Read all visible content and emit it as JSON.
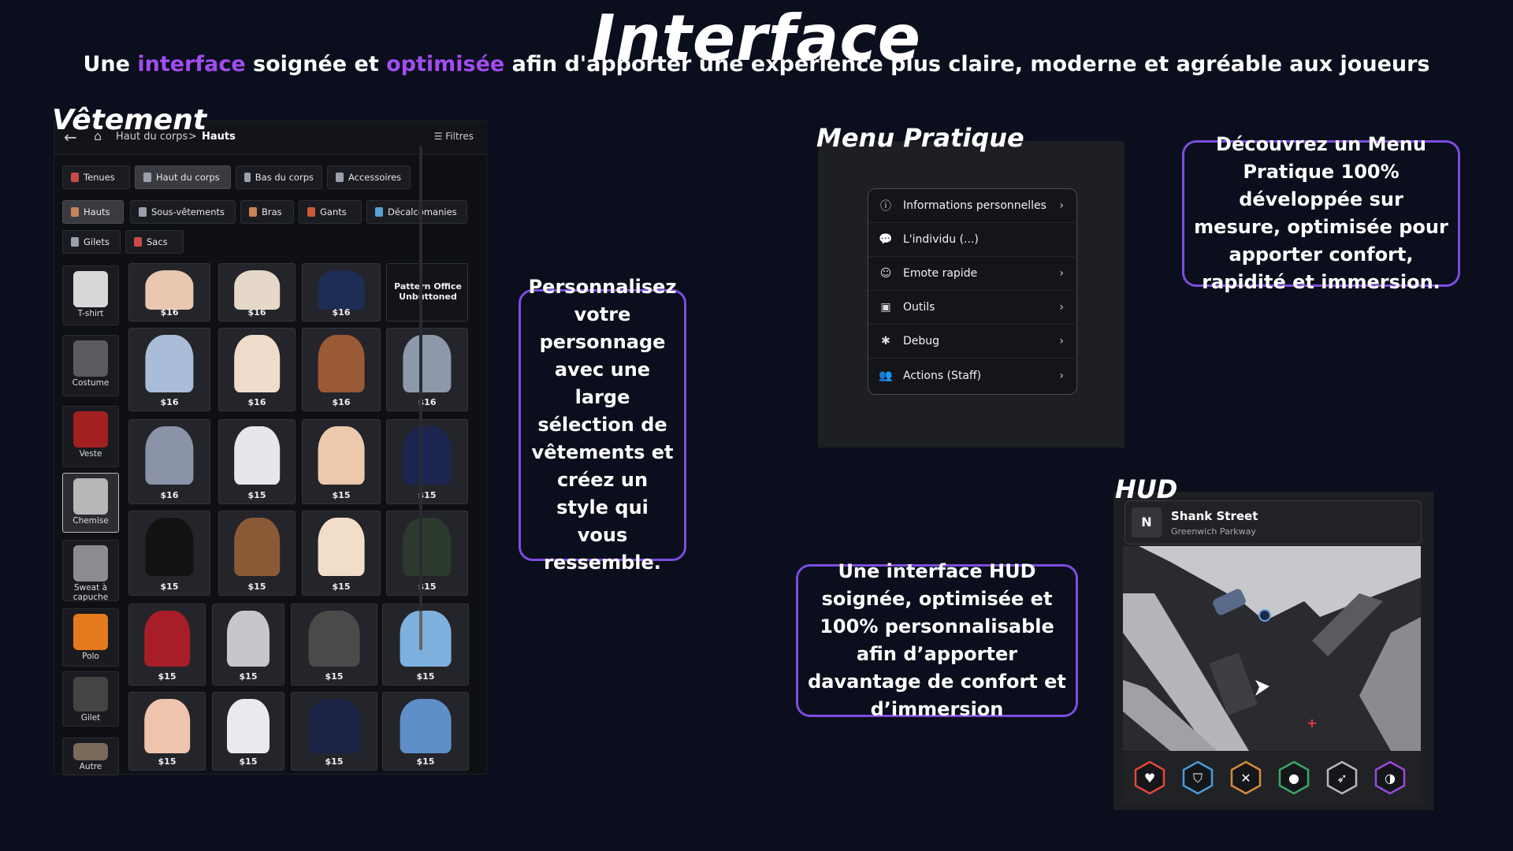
{
  "header": {
    "title": "Interface",
    "subtitle_parts": [
      "Une ",
      "interface",
      " soignée et ",
      "optimisée",
      " afin d'apporter une expérience plus claire, moderne et agréable aux joueurs"
    ]
  },
  "clothing": {
    "section_title": "Vêtement",
    "breadcrumb": {
      "root": "Haut du corps",
      "sep": ">",
      "current": "Hauts"
    },
    "filters_label": "Filtres",
    "main_tabs": [
      {
        "label": "Tenues",
        "color": "#c94a4a"
      },
      {
        "label": "Haut du corps",
        "color": "#9aa0aa",
        "active": true
      },
      {
        "label": "Bas du corps",
        "color": "#9aa0aa"
      },
      {
        "label": "Accessoires",
        "color": "#9aa0aa"
      }
    ],
    "sub_tabs": [
      {
        "label": "Hauts",
        "color": "#c9835a",
        "active": true
      },
      {
        "label": "Sous-vêtements",
        "color": "#9aa0aa"
      },
      {
        "label": "Bras",
        "color": "#c9835a"
      },
      {
        "label": "Gants",
        "color": "#c95a3a"
      },
      {
        "label": "Décalcomanies",
        "color": "#5aa0d0"
      },
      {
        "label": "Gilets",
        "color": "#9aa0aa"
      },
      {
        "label": "Sacs",
        "color": "#c94a4a"
      }
    ],
    "categories": [
      {
        "label": "T-shirt",
        "color": "#d8d8d8"
      },
      {
        "label": "Costume",
        "color": "#5a5c62"
      },
      {
        "label": "Veste",
        "color": "#a32020"
      },
      {
        "label": "Chemise",
        "color": "#b8b8b8",
        "active": true
      },
      {
        "label": "Sweat à capuche",
        "color": "#8a8c92"
      },
      {
        "label": "Polo",
        "color": "#e47a1c"
      },
      {
        "label": "Gilet",
        "color": "#444"
      },
      {
        "label": "Autre",
        "color": "#7a6a5a"
      }
    ],
    "items": [
      {
        "price": "$16",
        "color": "#e9c7b0"
      },
      {
        "price": "$16",
        "color": "#e6d8c8"
      },
      {
        "price": "$16",
        "color": "#1e2d55"
      },
      {
        "price": "",
        "label": "Pattern Office Unbuttoned",
        "color": ""
      },
      {
        "price": "$16",
        "color": "#a9bcd8"
      },
      {
        "price": "$16",
        "color": "#f0dccb"
      },
      {
        "price": "$16",
        "color": "#9a5a36"
      },
      {
        "price": "$16",
        "color": "#8e98ab"
      },
      {
        "price": "$16",
        "color": "#8a93a8"
      },
      {
        "price": "$15",
        "color": "#e6e7ea"
      },
      {
        "price": "$15",
        "color": "#ecc9ad"
      },
      {
        "price": "$15",
        "color": "#1c2550"
      },
      {
        "price": "$15",
        "color": "#121212"
      },
      {
        "price": "$15",
        "color": "#8a5a36"
      },
      {
        "price": "$15",
        "color": "#f2ddc9"
      },
      {
        "price": "$15",
        "color": "#2c3a2e"
      },
      {
        "price": "$15",
        "color": "#a81e28"
      },
      {
        "price": "$15",
        "color": "#c5c7cc"
      },
      {
        "price": "$15",
        "color": "#4a4a4a"
      },
      {
        "price": "$15",
        "color": "#7fb1df"
      },
      {
        "price": "$15",
        "color": "#efc4ae"
      },
      {
        "price": "$15",
        "color": "#e9eaee"
      },
      {
        "price": "$15",
        "color": "#1a2346"
      },
      {
        "price": "$15",
        "color": "#5e8fc8"
      }
    ]
  },
  "callouts": {
    "personnalisez": "Personnalisez votre personnage avec une large sélection de vêtements et créez un style qui vous ressemble.",
    "menu": "Découvrez un Menu Pratique 100% développée sur mesure, optimisée pour apporter confort, rapidité et immersion.",
    "hud": "Une interface HUD soignée, optimisée et 100% personnalisable afin d’apporter davantage de confort et d’immersion"
  },
  "menu": {
    "section_title": "Menu Pratique",
    "items": [
      {
        "label": "Informations personnelles",
        "icon": "info-icon",
        "chevron": true
      },
      {
        "label": "L'individu (...)",
        "icon": "chat-icon",
        "chevron": false
      },
      {
        "label": "Emote rapide",
        "icon": "smile-icon",
        "chevron": true
      },
      {
        "label": "Outils",
        "icon": "toolbox-icon",
        "chevron": true
      },
      {
        "label": "Debug",
        "icon": "bug-icon",
        "chevron": true
      },
      {
        "label": "Actions (Staff)",
        "icon": "staff-icon",
        "chevron": true
      }
    ]
  },
  "hud": {
    "section_title": "HUD",
    "compass": "N",
    "street": "Shank Street",
    "area": "Greenwich Parkway",
    "stats": [
      {
        "name": "health-icon",
        "color": "#e0483a"
      },
      {
        "name": "armor-icon",
        "color": "#4a9ad8"
      },
      {
        "name": "hunger-icon",
        "color": "#d98a3a"
      },
      {
        "name": "thirst-icon",
        "color": "#3aa86a"
      },
      {
        "name": "stamina-icon",
        "color": "#b8b8b8"
      },
      {
        "name": "lungs-icon",
        "color": "#9a4ad8"
      }
    ]
  }
}
